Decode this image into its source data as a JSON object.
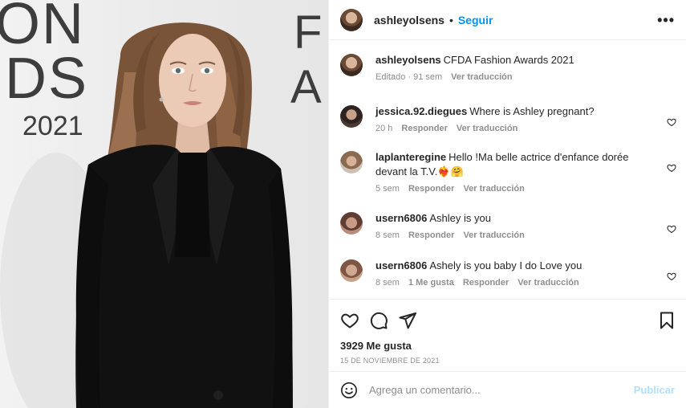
{
  "photo": {
    "backdrop_lines": [
      "ON",
      "DS",
      "2021",
      "F",
      "A"
    ]
  },
  "header": {
    "username": "ashleyolsens",
    "separator": "•",
    "follow_label": "Seguir",
    "more_label": "•••"
  },
  "caption": {
    "username": "ashleyolsens",
    "text": "CFDA Fashion Awards 2021",
    "time": "Editado · 91 sem",
    "translate": "Ver traducción"
  },
  "comments": [
    {
      "username": "jessica.92.diegues",
      "text": "Where is Ashley pregnant?",
      "time": "20 h",
      "likes": "",
      "reply": "Responder",
      "translate": "Ver traducción"
    },
    {
      "username": "laplanteregine",
      "text": "Hello !Ma belle actrice d'enfance dorée devant la T.V.❤️‍🔥🤗",
      "time": "5 sem",
      "likes": "",
      "reply": "Responder",
      "translate": "Ver traducción"
    },
    {
      "username": "usern6806",
      "text": "Ashley is you",
      "time": "8 sem",
      "likes": "",
      "reply": "Responder",
      "translate": "Ver traducción"
    },
    {
      "username": "usern6806",
      "text": "Ashely is you baby I do Love you",
      "time": "8 sem",
      "likes": "1 Me gusta",
      "reply": "Responder",
      "translate": "Ver traducción"
    }
  ],
  "stats": {
    "likes": "3929 Me gusta",
    "date": "15 de noviembre de 2021"
  },
  "composer": {
    "placeholder": "Agrega un comentario...",
    "publish_label": "Publicar"
  },
  "colors": {
    "accent": "#0095f6",
    "publish_disabled": "#b2dffc",
    "muted": "#8e8e8e"
  }
}
